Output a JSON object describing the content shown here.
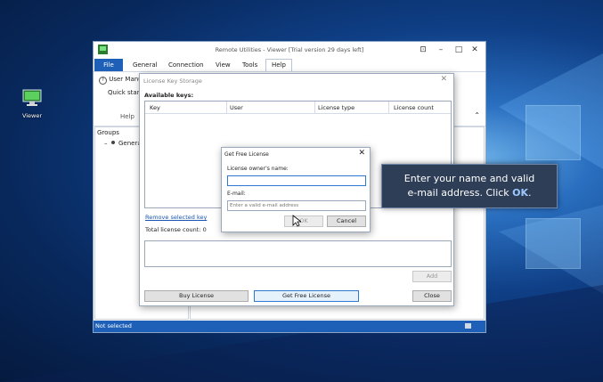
{
  "desktop": {
    "icon_label": "Viewer"
  },
  "window": {
    "title": "Remote Utilities - Viewer [Trial version 29 days left]",
    "menu": [
      "File",
      "General",
      "Connection",
      "View",
      "Tools",
      "Help"
    ],
    "ribbon_items": [
      "User Manual",
      "Quick start"
    ],
    "ribbon_group": "Help",
    "groups_header": "Groups",
    "groups_item": "General",
    "status": "Not selected"
  },
  "license_storage": {
    "title": "License Key Storage",
    "available_label": "Available keys:",
    "columns": [
      "Key",
      "User",
      "License type",
      "License count"
    ],
    "remove_link": "Remove selected key",
    "total_label": "Total license count: 0",
    "add_label": "Add",
    "buy_label": "Buy License",
    "get_free_label": "Get Free License",
    "close_label": "Close"
  },
  "get_free_dialog": {
    "title": "Get Free License",
    "name_label": "License owner's name:",
    "name_value": "",
    "email_label": "E-mail:",
    "email_placeholder": "Enter a valid e-mail address",
    "ok_label": "OK",
    "cancel_label": "Cancel"
  },
  "tooltip": {
    "line1": "Enter your name and valid",
    "line2_prefix": "e-mail address. Click ",
    "line2_emph": "OK",
    "line2_suffix": "."
  }
}
